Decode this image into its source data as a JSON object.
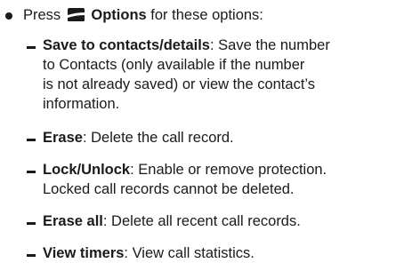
{
  "options_line": {
    "prefix": "Press",
    "softkey_icon": "left-softkey-icon",
    "label": "Options",
    "suffix": "for these options:"
  },
  "items": [
    {
      "term": "Save to contacts/details",
      "lines": [
        ": Save the number",
        "to Contacts (only available if the number",
        "is not already saved) or view the contact’s",
        "information."
      ]
    },
    {
      "term": "Erase",
      "lines": [
        ": Delete the call record."
      ]
    },
    {
      "term": "Lock/Unlock",
      "lines": [
        ": Enable or remove protection.",
        "Locked call records cannot be deleted."
      ]
    },
    {
      "term": "Erase all",
      "lines": [
        ": Delete all recent call records."
      ]
    },
    {
      "term": "View timers",
      "lines": [
        ": View call statistics."
      ]
    }
  ],
  "colors": {
    "text": "#1a1a1a",
    "background": "#ffffff"
  }
}
